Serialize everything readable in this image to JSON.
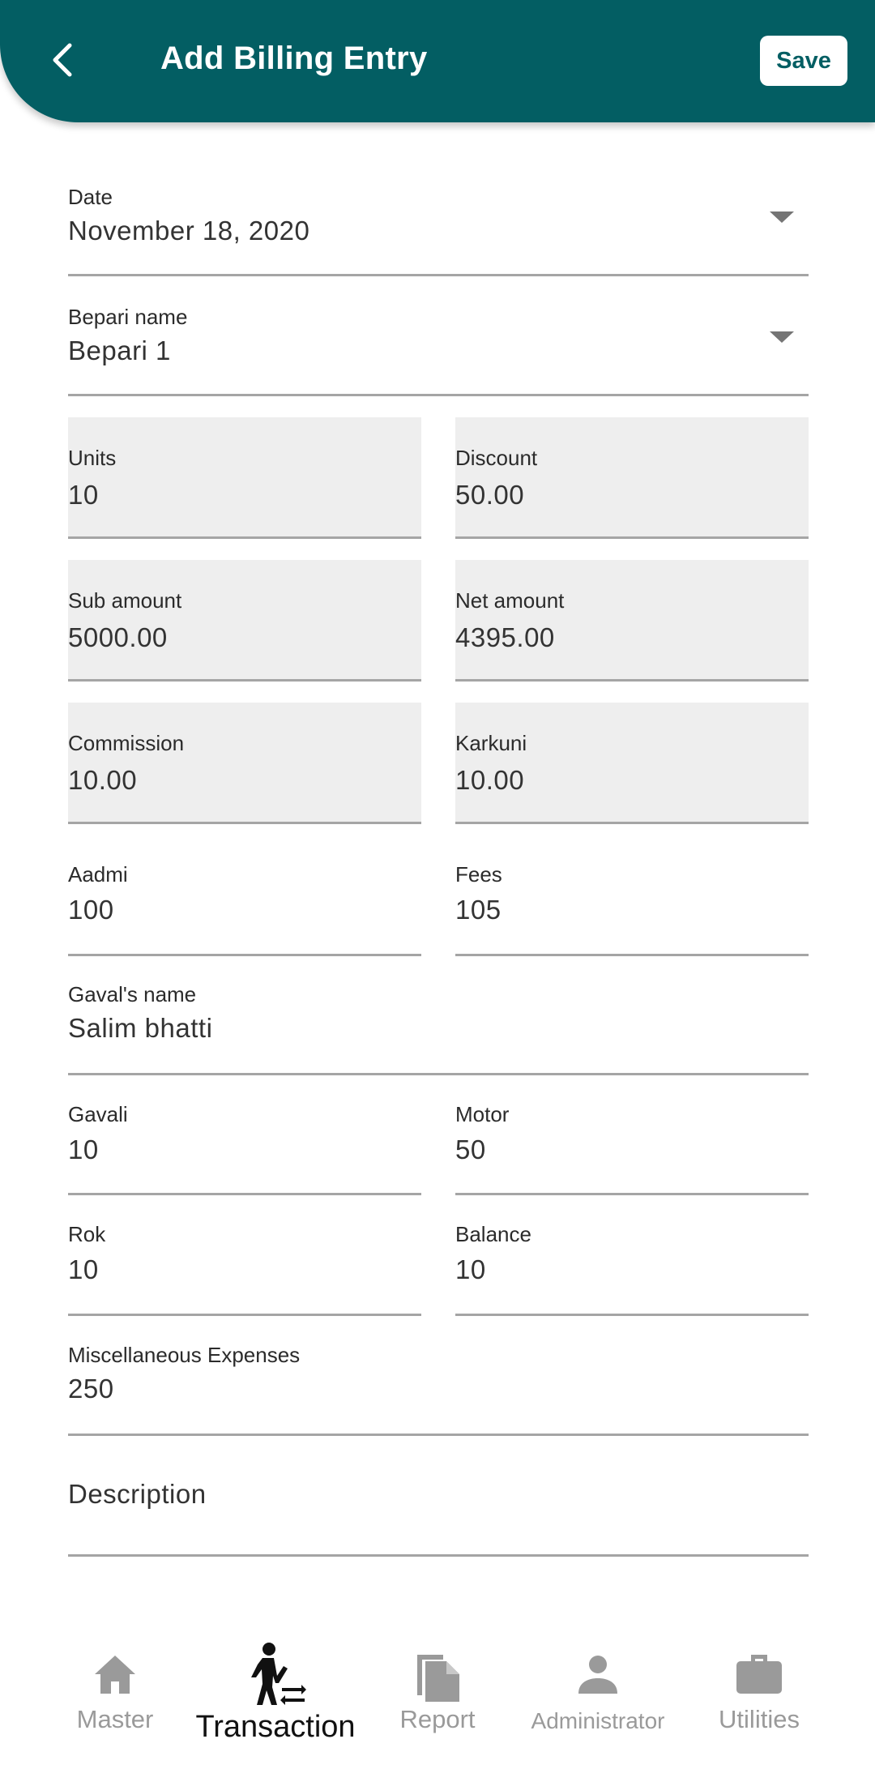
{
  "header": {
    "title": "Add Billing Entry",
    "save_label": "Save",
    "back_icon": "chevron-left-icon",
    "brand_color": "#035E63"
  },
  "form": {
    "date": {
      "label": "Date",
      "value": "November 18, 2020"
    },
    "bepari_name": {
      "label": "Bepari name",
      "value": "Bepari 1"
    },
    "units": {
      "label": "Units",
      "value": "10"
    },
    "discount": {
      "label": "Discount",
      "value": "50.00"
    },
    "sub_amount": {
      "label": "Sub amount",
      "value": "5000.00"
    },
    "net_amount": {
      "label": "Net amount",
      "value": "4395.00"
    },
    "commission": {
      "label": "Commission",
      "value": "10.00"
    },
    "karkuni": {
      "label": "Karkuni",
      "value": "10.00"
    },
    "aadmi": {
      "label": "Aadmi",
      "value": "100"
    },
    "fees": {
      "label": "Fees",
      "value": "105"
    },
    "gavals_name": {
      "label": "Gaval's name",
      "value": "Salim bhatti"
    },
    "gavali": {
      "label": "Gavali",
      "value": "10"
    },
    "motor": {
      "label": "Motor",
      "value": "50"
    },
    "rok": {
      "label": "Rok",
      "value": "10"
    },
    "balance": {
      "label": "Balance",
      "value": "10"
    },
    "misc_expenses": {
      "label": "Miscellaneous Expenses",
      "value": "250"
    },
    "description": {
      "placeholder": "Description",
      "value": ""
    }
  },
  "bottom_nav": {
    "active": "Transaction",
    "items": [
      {
        "label": "Master",
        "icon": "home-icon"
      },
      {
        "label": "Transaction",
        "icon": "person-transfer-icon"
      },
      {
        "label": "Report",
        "icon": "document-copy-icon"
      },
      {
        "label": "Administrator",
        "icon": "person-icon"
      },
      {
        "label": "Utilities",
        "icon": "briefcase-icon"
      }
    ]
  }
}
